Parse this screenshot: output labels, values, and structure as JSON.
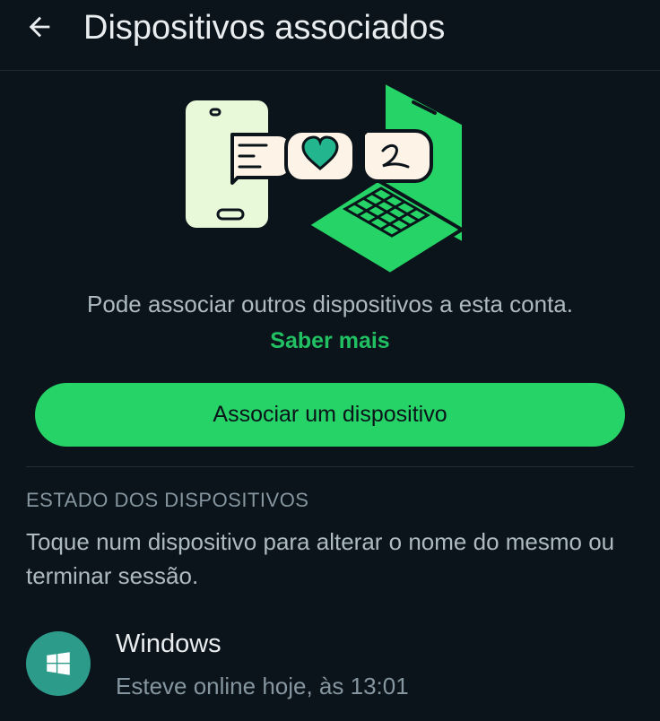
{
  "header": {
    "title": "Dispositivos associados",
    "back_icon": "arrow-left-icon"
  },
  "intro": {
    "description": "Pode associar outros dispositivos a esta conta.",
    "learn_more": "Saber mais"
  },
  "primary_action": {
    "label": "Associar um dispositivo"
  },
  "devices_section": {
    "header": "ESTADO DOS DISPOSITIVOS",
    "help": "Toque num dispositivo para alterar o nome do mesmo ou terminar sessão.",
    "items": [
      {
        "name": "Windows",
        "status": "Esteve online hoje, às 13:01",
        "icon": "windows-icon"
      }
    ]
  },
  "colors": {
    "background": "#0b141a",
    "accent": "#25d366",
    "link": "#21c063",
    "avatar": "#2d9b8a"
  }
}
